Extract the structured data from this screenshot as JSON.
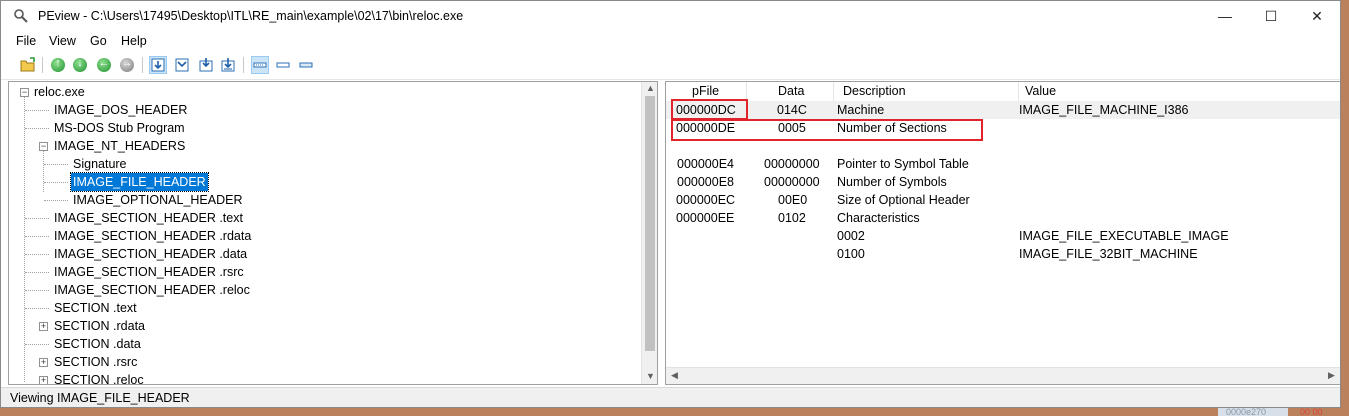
{
  "window": {
    "title": "PEview - C:\\Users\\17495\\Desktop\\ITL\\RE_main\\example\\02\\17\\bin\\reloc.exe",
    "controls": {
      "minimize": "—",
      "maximize": "☐",
      "close": "✕"
    }
  },
  "menu": [
    "File",
    "View",
    "Go",
    "Help"
  ],
  "toolbar": {
    "buttons": [
      {
        "name": "open-file-icon",
        "pressed": false
      },
      {
        "name": "go-up-icon",
        "pressed": false
      },
      {
        "name": "go-down-icon",
        "pressed": false
      },
      {
        "name": "go-back-icon",
        "pressed": false
      },
      {
        "name": "go-forward-icon",
        "pressed": false
      },
      {
        "name": "view-1-icon",
        "pressed": true
      },
      {
        "name": "view-2-icon",
        "pressed": false
      },
      {
        "name": "view-3-icon",
        "pressed": false
      },
      {
        "name": "view-4-icon",
        "pressed": false
      },
      {
        "name": "list-view-1-icon",
        "pressed": true
      },
      {
        "name": "list-view-2-icon",
        "pressed": false
      },
      {
        "name": "list-view-3-icon",
        "pressed": false
      }
    ]
  },
  "tree": {
    "items": [
      {
        "label": "reloc.exe",
        "level": 0,
        "expander": "−"
      },
      {
        "label": "IMAGE_DOS_HEADER",
        "level": 1
      },
      {
        "label": "MS-DOS Stub Program",
        "level": 1
      },
      {
        "label": "IMAGE_NT_HEADERS",
        "level": 1,
        "expander": "−"
      },
      {
        "label": "Signature",
        "level": 2
      },
      {
        "label": "IMAGE_FILE_HEADER",
        "level": 2,
        "selected": true
      },
      {
        "label": "IMAGE_OPTIONAL_HEADER",
        "level": 2
      },
      {
        "label": "IMAGE_SECTION_HEADER .text",
        "level": 1
      },
      {
        "label": "IMAGE_SECTION_HEADER .rdata",
        "level": 1
      },
      {
        "label": "IMAGE_SECTION_HEADER .data",
        "level": 1
      },
      {
        "label": "IMAGE_SECTION_HEADER .rsrc",
        "level": 1
      },
      {
        "label": "IMAGE_SECTION_HEADER .reloc",
        "level": 1
      },
      {
        "label": "SECTION .text",
        "level": 1
      },
      {
        "label": "SECTION .rdata",
        "level": 1,
        "expander": "+"
      },
      {
        "label": "SECTION .data",
        "level": 1
      },
      {
        "label": "SECTION .rsrc",
        "level": 1,
        "expander": "+"
      },
      {
        "label": "SECTION .reloc",
        "level": 1,
        "expander": "+"
      }
    ]
  },
  "list": {
    "columns": [
      "pFile",
      "Data",
      "Description",
      "Value"
    ],
    "rows": [
      {
        "pfile": "000000DC",
        "data": "014C",
        "description": "Machine",
        "value": "IMAGE_FILE_MACHINE_I386",
        "highlighted": true
      },
      {
        "pfile": "000000DE",
        "data": "0005",
        "description": "Number of Sections",
        "value": ""
      },
      {
        "pfile": "",
        "data": "",
        "description": "",
        "value": ""
      },
      {
        "pfile": "000000E4",
        "data": "00000000",
        "description": "Pointer to Symbol Table",
        "value": ""
      },
      {
        "pfile": "000000E8",
        "data": "00000000",
        "description": "Number of Symbols",
        "value": ""
      },
      {
        "pfile": "000000EC",
        "data": "00E0",
        "description": "Size of Optional Header",
        "value": ""
      },
      {
        "pfile": "000000EE",
        "data": "0102",
        "description": "Characteristics",
        "value": ""
      },
      {
        "pfile": "",
        "data": "",
        "description": "0002",
        "value": "IMAGE_FILE_EXECUTABLE_IMAGE"
      },
      {
        "pfile": "",
        "data": "",
        "description": "0100",
        "value": "IMAGE_FILE_32BIT_MACHINE"
      }
    ]
  },
  "status": {
    "text": "Viewing IMAGE_FILE_HEADER"
  },
  "background_fragments": {
    "corner_text_1": "0000e270",
    "corner_text_2": "00 00"
  },
  "colors": {
    "selection": "#0078d7",
    "annotation_red": "#e0242a",
    "row_highlight": "#f0f0f0"
  }
}
